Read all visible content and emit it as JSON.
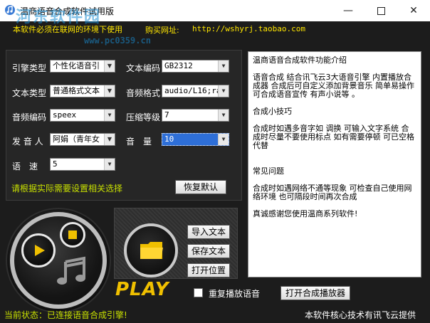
{
  "window": {
    "title": "温商语音合成软件试用版",
    "watermark": "河东软件园",
    "watermark_url": "www.pc0359.cn"
  },
  "banner": {
    "text": "本软件必须在联网的环境下使用",
    "buy_label": "购买网址:",
    "buy_url": "http://wshyrj.taobao.com"
  },
  "settings": {
    "engine_label": "引擎类型",
    "engine_value": "个性化语音引",
    "encoding_label": "文本编码",
    "encoding_value": "GB2312",
    "text_type_label": "文本类型",
    "text_type_value": "普通格式文本",
    "audio_format_label": "音频格式",
    "audio_format_value": "audio/L16;ra",
    "audio_codec_label": "音频编码",
    "audio_codec_value": "speex",
    "compress_label": "压缩等级",
    "compress_value": "7",
    "speaker_label": "发 音 人",
    "speaker_value": "阿娟（青年女",
    "volume_label": "音　量",
    "volume_value": "10",
    "speed_label": "语　速",
    "speed_value": "5",
    "hint": "请根据实际需要设置相关选择",
    "reset_label": "恢复默认"
  },
  "text_panel": {
    "lines": [
      "温商语音合成软件功能介绍",
      "语音合成   结合讯飞云3大语音引擎 内置播放合成器 合成后可自定义添加背景音乐 简单易操作 可合成语音宣传 有声小说等 。",
      "合成小技巧",
      "合成时如遇多音字如 调换 可输入文字系统 合成时尽量不要使用标点 如有需要停顿 可已空格代替",
      "常见问题",
      "合成时如遇网络不通等现象 可检查自己使用网络环境 也可隔段时间再次合成",
      "真诚感谢您使用温商系列软件!"
    ]
  },
  "files": {
    "import_label": "导入文本",
    "save_label": "保存文本",
    "open_label": "打开位置"
  },
  "player": {
    "logo": "PLAY",
    "repeat_label": "重复播放语音",
    "open_player_label": "打开合成播放器"
  },
  "status": {
    "text": "当前状态：已连接语音合成引擎!",
    "credit": "本软件核心技术有讯飞云提供"
  },
  "colors": {
    "background": "#1c1c1c",
    "accent_yellow": "#ffe600",
    "status_green": "#c8e000",
    "selected_blue": "#2e6fd8"
  }
}
